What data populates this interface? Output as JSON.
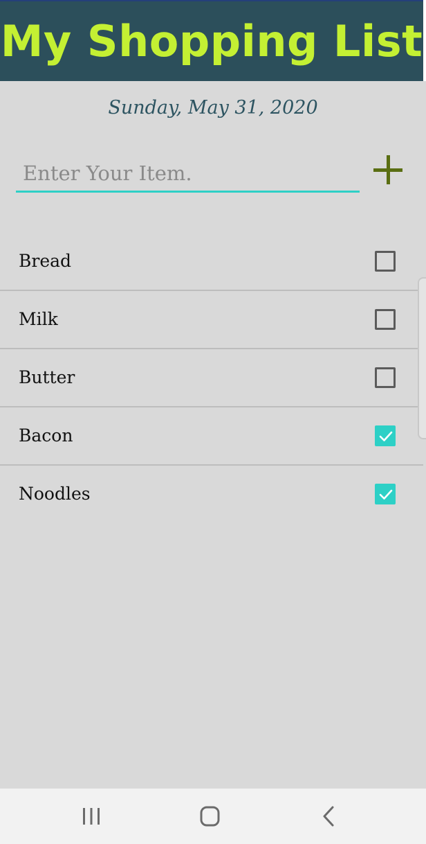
{
  "header": {
    "title": "My Shopping List"
  },
  "date_label": "Sunday, May 31, 2020",
  "new_item": {
    "placeholder": "Enter Your Item.",
    "value": "",
    "add_icon": "plus-icon"
  },
  "items": [
    {
      "label": "Bread",
      "checked": false
    },
    {
      "label": "Milk",
      "checked": false
    },
    {
      "label": "Butter",
      "checked": false
    },
    {
      "label": "Bacon",
      "checked": true
    },
    {
      "label": "Noodles",
      "checked": true
    }
  ],
  "navbar": {
    "recents_icon": "recents-icon",
    "home_icon": "home-icon",
    "back_icon": "back-icon"
  },
  "colors": {
    "header_bg": "#2c4f5b",
    "title": "#c4f033",
    "accent": "#2dd0c6",
    "add_button": "#5a6e12",
    "background": "#d9d9d9"
  }
}
